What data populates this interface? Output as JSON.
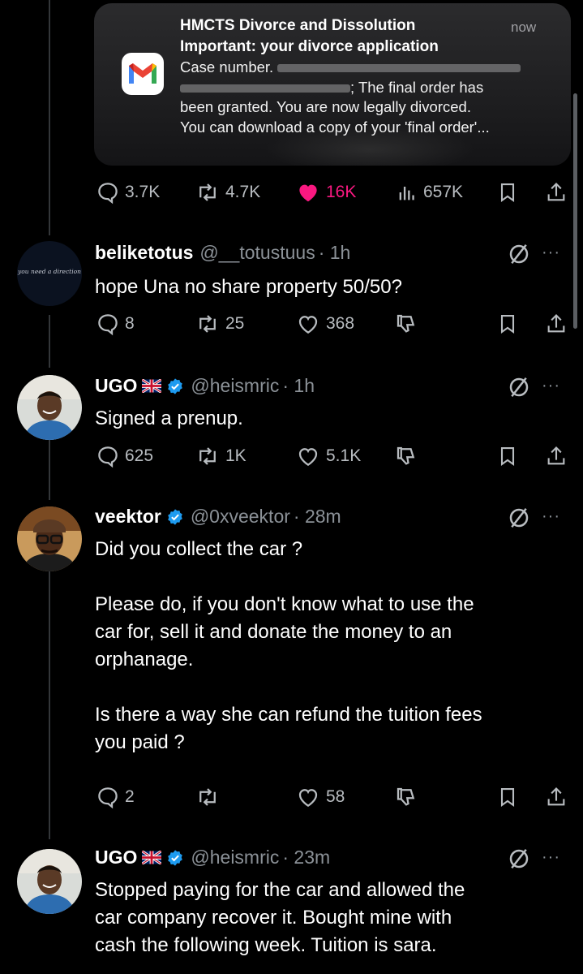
{
  "notification": {
    "app": "Gmail",
    "title": "HMCTS Divorce and Dissolution",
    "subject": "Important: your divorce application",
    "case_label": "Case number.",
    "body_1": "; The final order has",
    "body_2": "been granted. You are now legally divorced.",
    "body_3": "You can download a copy of your 'final order'...",
    "time": "now"
  },
  "main_actions": {
    "replies": "3.7K",
    "reposts": "4.7K",
    "likes": "16K",
    "views": "657K"
  },
  "tweets": [
    {
      "name": "beliketotus",
      "handle": "@__totustuus",
      "time": "· 1h",
      "avatar_text": "you need a direction",
      "lines": [
        "hope Una no share property 50/50?"
      ],
      "replies": "8",
      "reposts": "25",
      "likes": "368"
    },
    {
      "name": "UGO",
      "handle": "@heismric",
      "time": "· 1h",
      "lines": [
        "Signed a prenup."
      ],
      "replies": "625",
      "reposts": "1K",
      "likes": "5.1K"
    },
    {
      "name": "veektor",
      "handle": "@0xveektor",
      "time": "· 28m",
      "para_1": "Did you collect the car ?",
      "para_2_line_1": "Please do, if you don't know what to use the",
      "para_2_line_2": "car for, sell it and donate the money to an",
      "para_2_line_3": "orphanage.",
      "para_3_line_1": "Is there a way she can refund the tuition fees",
      "para_3_line_2": "you paid ?",
      "replies": "2",
      "reposts": "",
      "likes": "58"
    },
    {
      "name": "UGO",
      "handle": "@heismric",
      "time": "· 23m",
      "line_1": "Stopped paying for the car and allowed the",
      "line_2": "car company recover it. Bought mine with",
      "line_3": "cash the following week. Tuition is sara."
    }
  ],
  "colors": {
    "background": "#000000",
    "text": "#e7e9ea",
    "secondary": "#8b9197",
    "like": "#f91880",
    "verified": "#1d9bf0"
  }
}
